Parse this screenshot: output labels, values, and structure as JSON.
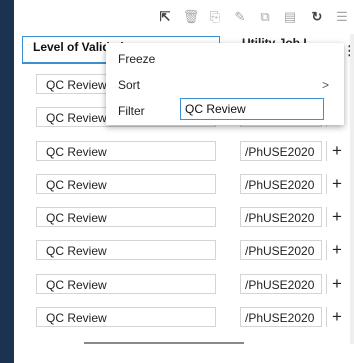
{
  "toolbar": {
    "icons": [
      "export-icon",
      "delete-icon",
      "copy-icon",
      "edit-icon",
      "duplicate-icon",
      "clipboard-icon",
      "refresh-icon",
      "list-icon"
    ]
  },
  "table": {
    "col_level_header": "Level of Validation",
    "col_path_header": "Utility Job L",
    "rows": [
      {
        "level": "QC Review",
        "path": ""
      },
      {
        "level": "QC Review",
        "path": ""
      },
      {
        "level": "QC Review",
        "path": "/PhUSE2020"
      },
      {
        "level": "QC Review",
        "path": "/PhUSE2020"
      },
      {
        "level": "QC Review",
        "path": "/PhUSE2020"
      },
      {
        "level": "QC Review",
        "path": "/PhUSE2020"
      },
      {
        "level": "QC Review",
        "path": "/PhUSE2020"
      },
      {
        "level": "QC Review",
        "path": "/PhUSE2020"
      }
    ],
    "add_symbol": "+"
  },
  "context_menu": {
    "freeze_label": "Freeze",
    "sort_label": "Sort",
    "sort_arrow": ">",
    "filter_label": "Filter",
    "filter_value": "QC Review"
  }
}
